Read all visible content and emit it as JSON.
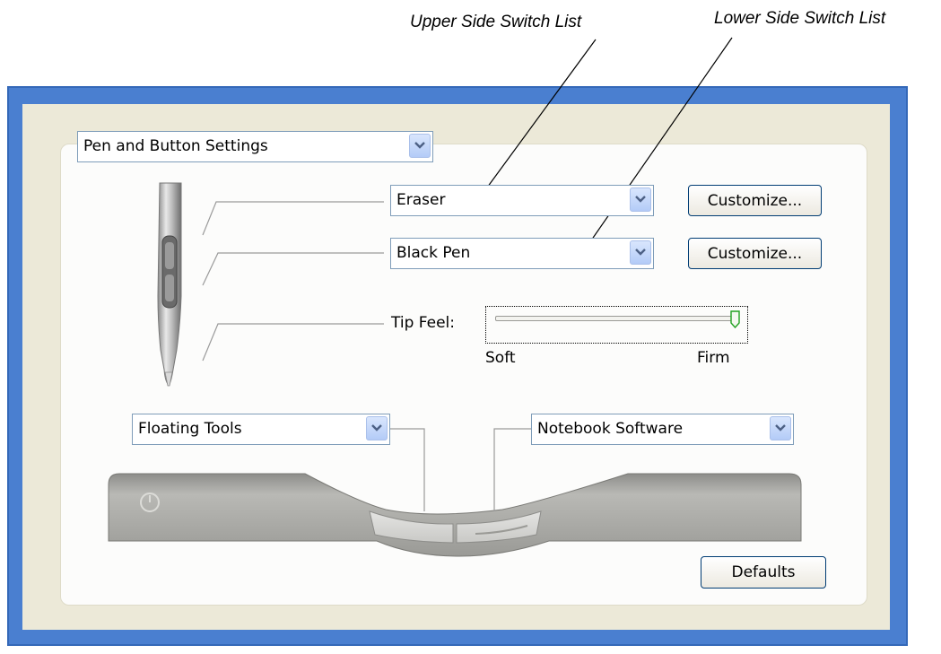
{
  "callouts": {
    "upper": "Upper Side Switch List",
    "lower": "Lower Side Switch List"
  },
  "settings_dropdown": {
    "value": "Pen and Button Settings"
  },
  "upper_switch": {
    "value": "Eraser",
    "customize_label": "Customize..."
  },
  "lower_switch": {
    "value": "Black Pen",
    "customize_label": "Customize..."
  },
  "tip_feel": {
    "label": "Tip Feel:",
    "min_label": "Soft",
    "max_label": "Firm",
    "level_fraction": 1.0
  },
  "left_button": {
    "value": "Floating Tools"
  },
  "right_button": {
    "value": "Notebook Software"
  },
  "defaults_label": "Defaults",
  "colors": {
    "frame": "#4a7fd0",
    "panel_bg": "#ece9d8",
    "button_border": "#003c74"
  }
}
